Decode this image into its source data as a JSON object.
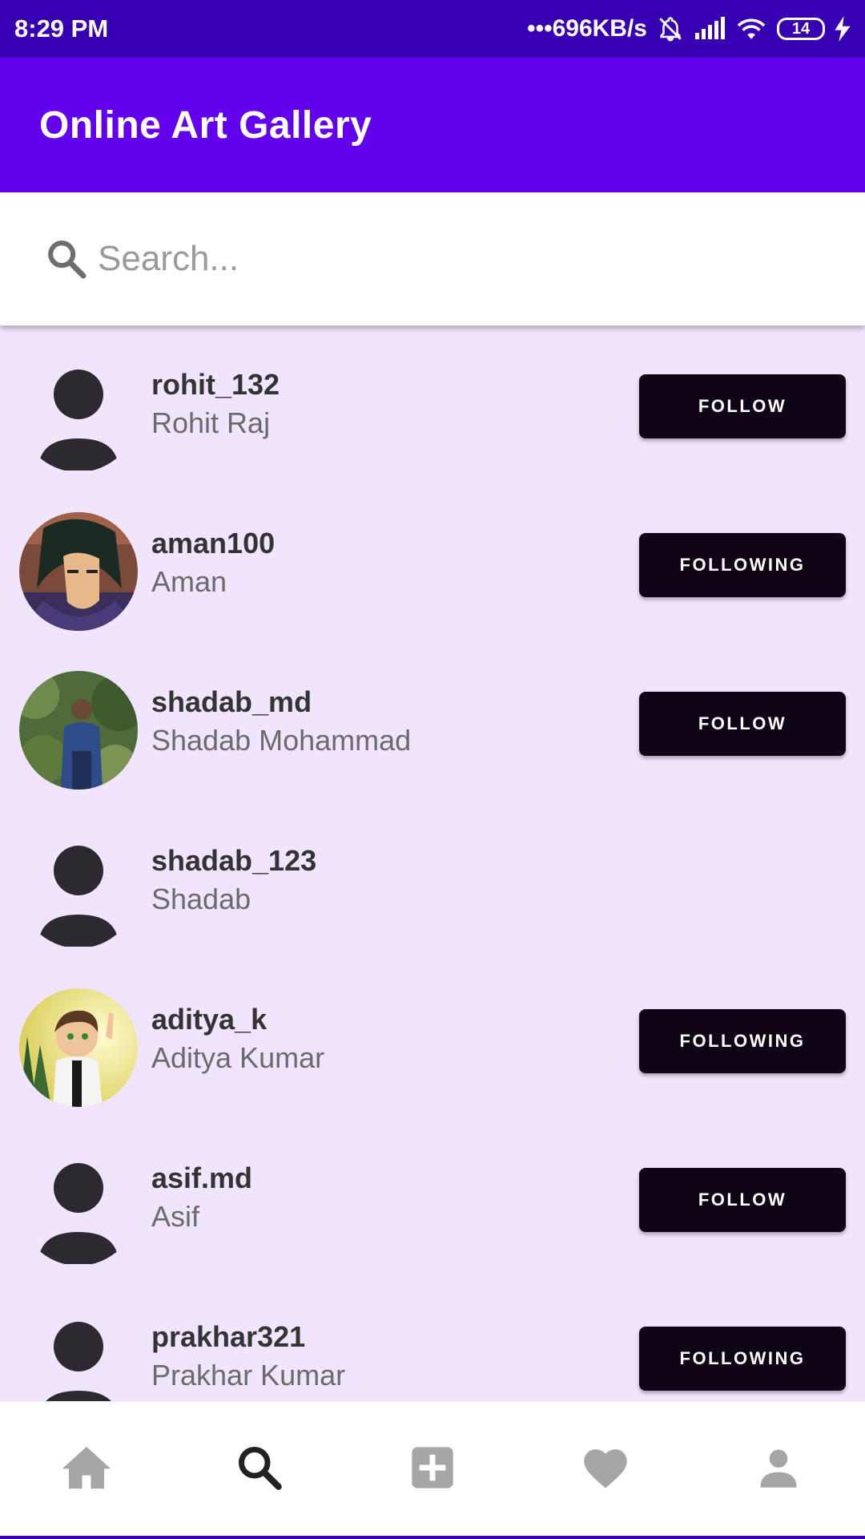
{
  "status_bar": {
    "time": "8:29 PM",
    "network_speed": "•••696KB/s",
    "battery": "14",
    "icons": [
      "muted-bell-icon",
      "signal-icon",
      "wifi-icon",
      "battery-icon",
      "charging-bolt-icon"
    ]
  },
  "app_bar": {
    "title": "Online Art Gallery"
  },
  "search": {
    "placeholder": "Search...",
    "value": ""
  },
  "users": [
    {
      "username": "rohit_132",
      "name": "Rohit Raj",
      "avatar": "default-user-avatar",
      "action": "FOLLOW"
    },
    {
      "username": "aman100",
      "name": "Aman",
      "avatar": "cartoon-character-photo",
      "action": "FOLLOWING"
    },
    {
      "username": "shadab_md",
      "name": "Shadab Mohammad",
      "avatar": "person-outdoors-photo",
      "action": "FOLLOW"
    },
    {
      "username": "shadab_123",
      "name": "Shadab",
      "avatar": "default-user-avatar",
      "action": ""
    },
    {
      "username": "aditya_k",
      "name": "Aditya Kumar",
      "avatar": "cartoon-boy-photo",
      "action": "FOLLOWING"
    },
    {
      "username": "asif.md",
      "name": "Asif",
      "avatar": "default-user-avatar",
      "action": "FOLLOW"
    },
    {
      "username": "prakhar321",
      "name": "Prakhar Kumar",
      "avatar": "default-user-avatar",
      "action": "FOLLOWING"
    }
  ],
  "bottom_nav": [
    {
      "icon": "home-icon",
      "active": false
    },
    {
      "icon": "search-icon",
      "active": true
    },
    {
      "icon": "add-box-icon",
      "active": false
    },
    {
      "icon": "heart-icon",
      "active": false
    },
    {
      "icon": "profile-icon",
      "active": false
    }
  ],
  "colors": {
    "status_bar": "#3700b3",
    "app_bar": "#6200ee",
    "list_background": "#f1e4fd",
    "button": "#0f0517",
    "nav_active": "#222222",
    "nav_inactive": "#a6a6a6"
  }
}
